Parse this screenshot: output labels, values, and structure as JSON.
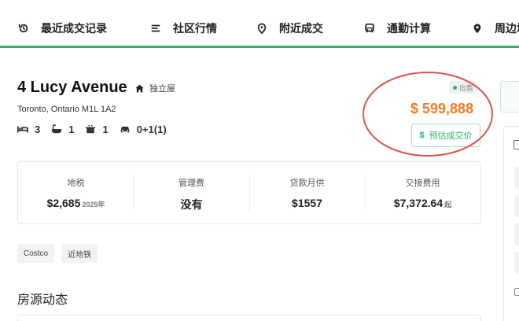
{
  "nav": {
    "items": [
      {
        "label": "最近成交记录",
        "icon": "history-icon"
      },
      {
        "label": "社区行情",
        "icon": "list-icon"
      },
      {
        "label": "附近成交",
        "icon": "location-pin-icon"
      },
      {
        "label": "通勤计算",
        "icon": "bus-icon"
      },
      {
        "label": "周边坩",
        "icon": "map-pin-icon"
      }
    ],
    "accent": "#2eb36c"
  },
  "listing": {
    "title": "4 Lucy Avenue",
    "type": "独立屋",
    "address": "Toronto, Ontario M1L 1A2",
    "features": {
      "bedrooms": "3",
      "bathrooms": "1",
      "kitchens": "1",
      "parking": "0+1(1)"
    },
    "status": "出售",
    "price": "$ 599,888",
    "price_color": "#f07b23",
    "estimate_button": "预估成交价",
    "estimate_icon": "$"
  },
  "stats": [
    {
      "label": "地税",
      "value": "$2,685",
      "sub": "2025年"
    },
    {
      "label": "管理费",
      "value": "没有",
      "sub": ""
    },
    {
      "label": "贷款月供",
      "value": "$1557",
      "sub": ""
    },
    {
      "label": "交接费用",
      "value": "$7,372.64",
      "sub": "起"
    }
  ],
  "tags": [
    "Costco",
    "近地铁"
  ],
  "section": {
    "title": "房源动态"
  }
}
